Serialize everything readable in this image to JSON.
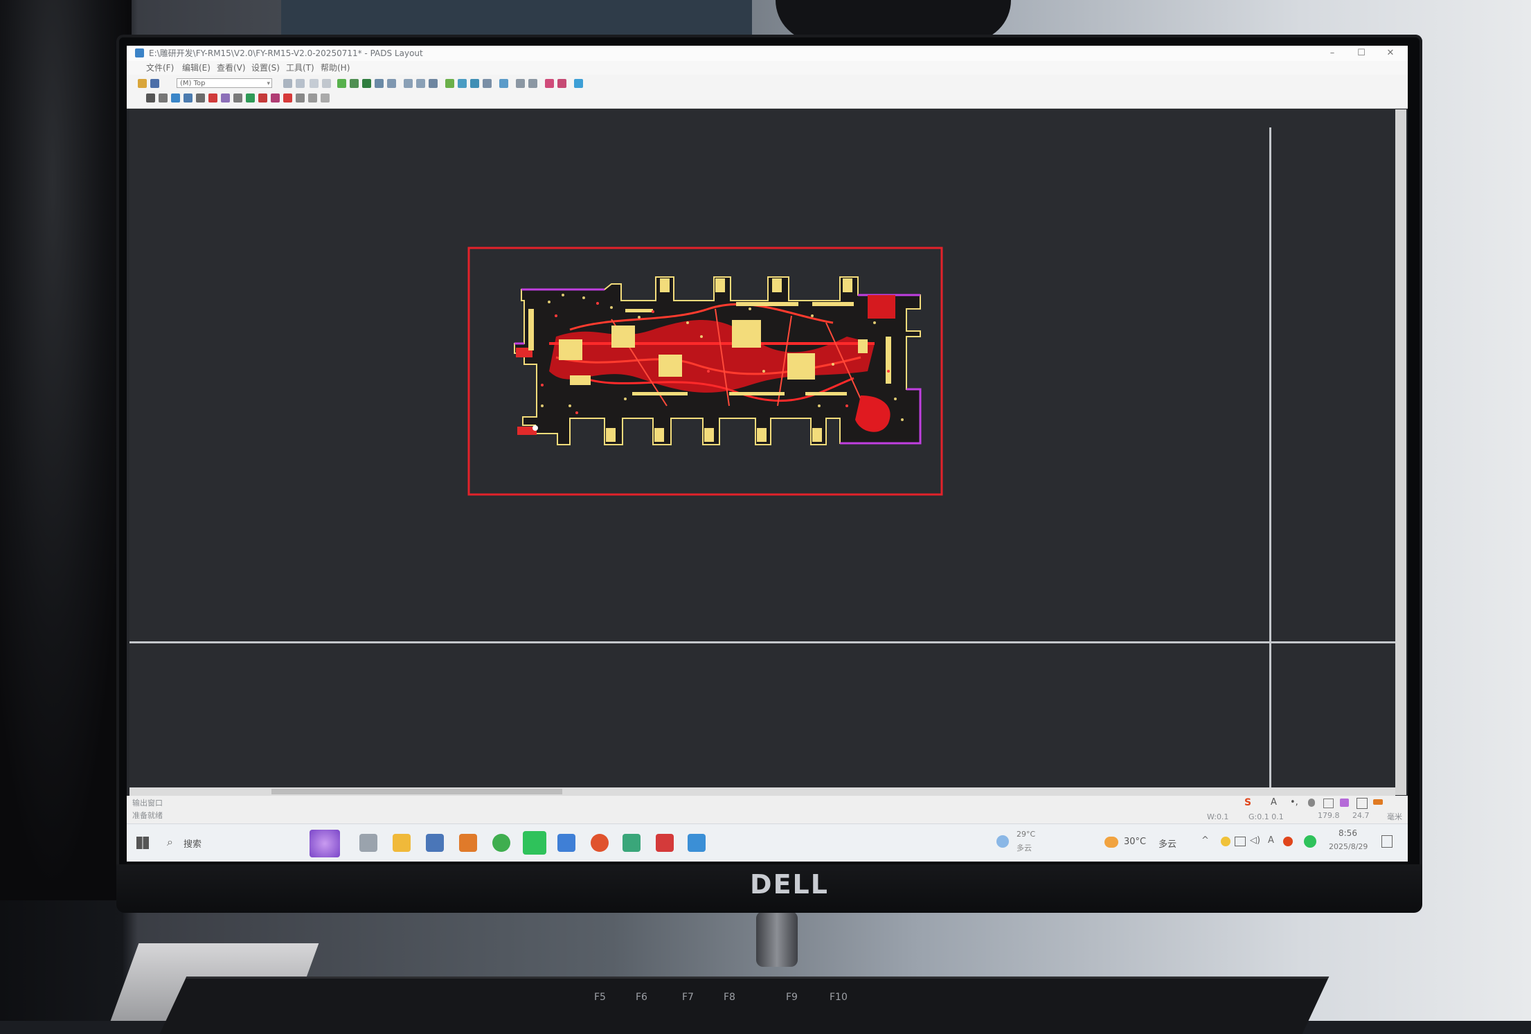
{
  "window": {
    "title": "E:\\雕研开发\\FY-RM15\\V2.0\\FY-RM15-V2.0-20250711* - PADS Layout",
    "controls": [
      "–",
      "☐",
      "✕"
    ]
  },
  "menubar": {
    "items": [
      "文件(F)",
      "编辑(E)",
      "查看(V)",
      "设置(S)",
      "工具(T)",
      "帮助(H)"
    ]
  },
  "toolbar": {
    "layer_select": "(M) Top"
  },
  "statusbar": {
    "output_window_label": "输出窗口",
    "ready_text": "准备就绪",
    "w_value": "W:0.1",
    "g_value": "G:0.1 0.1",
    "x_value": "179.8",
    "y_value": "24.7",
    "units": "毫米",
    "ime_icons": [
      "S",
      "A",
      "•,",
      "mic",
      "kbd",
      "shirt",
      "grid",
      "tool"
    ]
  },
  "taskbar": {
    "search_placeholder": "搜索",
    "weather_left": {
      "temp": "29°C",
      "desc": "多云"
    },
    "weather_right": {
      "temp": "30°C",
      "desc": "多云"
    },
    "clock": {
      "time": "8:56",
      "date": "2025/8/29"
    }
  },
  "monitor": {
    "brand": "DELL"
  },
  "keyboard": {
    "keys": [
      "F5",
      "F6",
      "F7",
      "F8",
      "F9",
      "F10"
    ]
  },
  "colors": {
    "board_outline": "#e3222a",
    "trace": "#ff1a1a",
    "pad": "#f3dc7b",
    "keepout": "#c03fe0",
    "canvas_bg": "#2a2c30"
  }
}
